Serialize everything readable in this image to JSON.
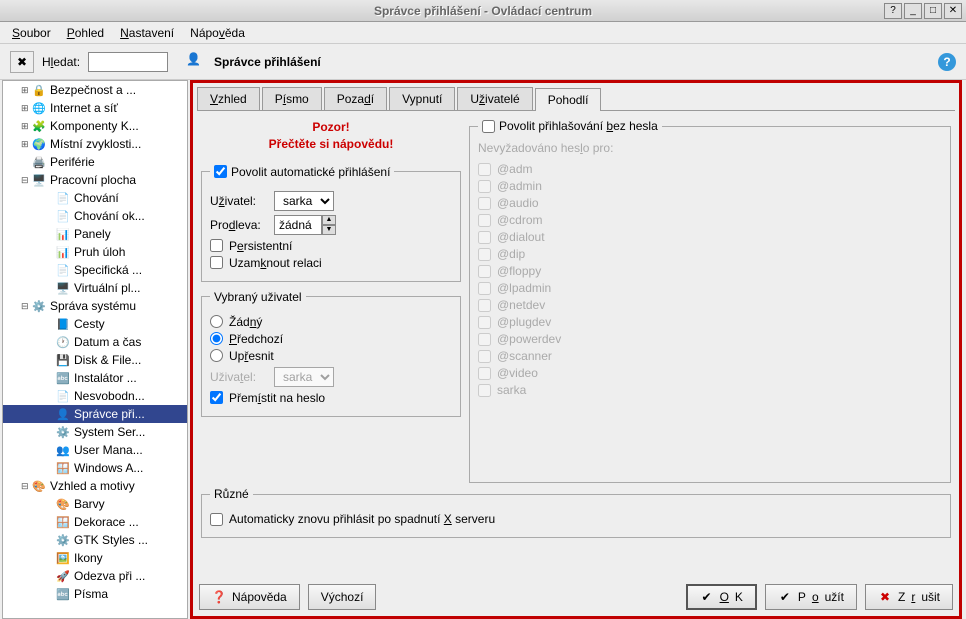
{
  "window": {
    "title": "Správce přihlášení - Ovládací centrum"
  },
  "menubar": {
    "file": "Soubor",
    "view": "Pohled",
    "settings": "Nastavení",
    "help": "Nápověda"
  },
  "search": {
    "label": "Hledat:",
    "value": ""
  },
  "header": {
    "title": "Správce přihlášení"
  },
  "tree": {
    "items": [
      {
        "level": 1,
        "exp": "⊞",
        "icon": "🔒",
        "label": "Bezpečnost a ..."
      },
      {
        "level": 1,
        "exp": "⊞",
        "icon": "🌐",
        "label": "Internet a síť"
      },
      {
        "level": 1,
        "exp": "⊞",
        "icon": "🧩",
        "label": "Komponenty K..."
      },
      {
        "level": 1,
        "exp": "⊞",
        "icon": "🌍",
        "label": "Místní zvyklosti..."
      },
      {
        "level": 1,
        "exp": "",
        "icon": "🖨️",
        "label": "Periférie"
      },
      {
        "level": 1,
        "exp": "⊟",
        "icon": "🖥️",
        "label": "Pracovní plocha"
      },
      {
        "level": 2,
        "exp": "",
        "icon": "📄",
        "label": "Chování"
      },
      {
        "level": 2,
        "exp": "",
        "icon": "📄",
        "label": "Chování ok..."
      },
      {
        "level": 2,
        "exp": "",
        "icon": "📊",
        "label": "Panely"
      },
      {
        "level": 2,
        "exp": "",
        "icon": "📊",
        "label": "Pruh úloh"
      },
      {
        "level": 2,
        "exp": "",
        "icon": "📄",
        "label": "Specifická ..."
      },
      {
        "level": 2,
        "exp": "",
        "icon": "🖥️",
        "label": "Virtuální pl..."
      },
      {
        "level": 1,
        "exp": "⊟",
        "icon": "⚙️",
        "label": "Správa systému"
      },
      {
        "level": 2,
        "exp": "",
        "icon": "📘",
        "label": "Cesty"
      },
      {
        "level": 2,
        "exp": "",
        "icon": "🕐",
        "label": "Datum a čas"
      },
      {
        "level": 2,
        "exp": "",
        "icon": "💾",
        "label": "Disk & File..."
      },
      {
        "level": 2,
        "exp": "",
        "icon": "🔤",
        "label": "Instalátor ..."
      },
      {
        "level": 2,
        "exp": "",
        "icon": "📄",
        "label": "Nesvobodn..."
      },
      {
        "level": 2,
        "exp": "",
        "icon": "👤",
        "label": "Správce při...",
        "selected": true
      },
      {
        "level": 2,
        "exp": "",
        "icon": "⚙️",
        "label": "System Ser..."
      },
      {
        "level": 2,
        "exp": "",
        "icon": "👥",
        "label": "User Mana..."
      },
      {
        "level": 2,
        "exp": "",
        "icon": "🪟",
        "label": "Windows A..."
      },
      {
        "level": 1,
        "exp": "⊟",
        "icon": "🎨",
        "label": "Vzhled a motivy"
      },
      {
        "level": 2,
        "exp": "",
        "icon": "🎨",
        "label": "Barvy"
      },
      {
        "level": 2,
        "exp": "",
        "icon": "🪟",
        "label": "Dekorace ..."
      },
      {
        "level": 2,
        "exp": "",
        "icon": "⚙️",
        "label": "GTK Styles ..."
      },
      {
        "level": 2,
        "exp": "",
        "icon": "🖼️",
        "label": "Ikony"
      },
      {
        "level": 2,
        "exp": "",
        "icon": "🚀",
        "label": "Odezva při ..."
      },
      {
        "level": 2,
        "exp": "",
        "icon": "🔤",
        "label": "Písma"
      }
    ]
  },
  "tabs": [
    {
      "label": "Vzhled",
      "u": "V"
    },
    {
      "label": "Písmo",
      "u": "í"
    },
    {
      "label": "Pozadí",
      "u": "d"
    },
    {
      "label": "Vypnutí",
      "u": ""
    },
    {
      "label": "Uživatelé",
      "u": "ž"
    },
    {
      "label": "Pohodlí",
      "u": "",
      "active": true
    }
  ],
  "warning": {
    "line1": "Pozor!",
    "line2": "Přečtěte si nápovědu!"
  },
  "autologin": {
    "legend": "Povolit automatické přihlášení",
    "enabled": true,
    "user_label": "Uživatel:",
    "user_value": "sarka",
    "delay_label": "Prodleva:",
    "delay_value": "žádná",
    "persistent": "Persistentní",
    "lock": "Uzamknout relaci"
  },
  "preselect": {
    "legend": "Vybraný uživatel",
    "none": "Žádný",
    "previous": "Předchozí",
    "specify": "Upřesnit",
    "user_label": "Uživatel:",
    "user_value": "sarka",
    "focus_pw": "Přemístit na heslo"
  },
  "nopass": {
    "legend": "Povolit přihlašování bez hesla",
    "list_label": "Nevyžadováno heslo pro:",
    "items": [
      "@adm",
      "@admin",
      "@audio",
      "@cdrom",
      "@dialout",
      "@dip",
      "@floppy",
      "@lpadmin",
      "@netdev",
      "@plugdev",
      "@powerdev",
      "@scanner",
      "@video",
      "sarka"
    ]
  },
  "misc": {
    "legend": "Různé",
    "autorelogin": "Automaticky znovu přihlásit po spadnutí X serveru"
  },
  "buttons": {
    "help": "Nápověda",
    "defaults": "Výchozí",
    "ok": "OK",
    "apply": "Použít",
    "cancel": "Zrušit"
  }
}
